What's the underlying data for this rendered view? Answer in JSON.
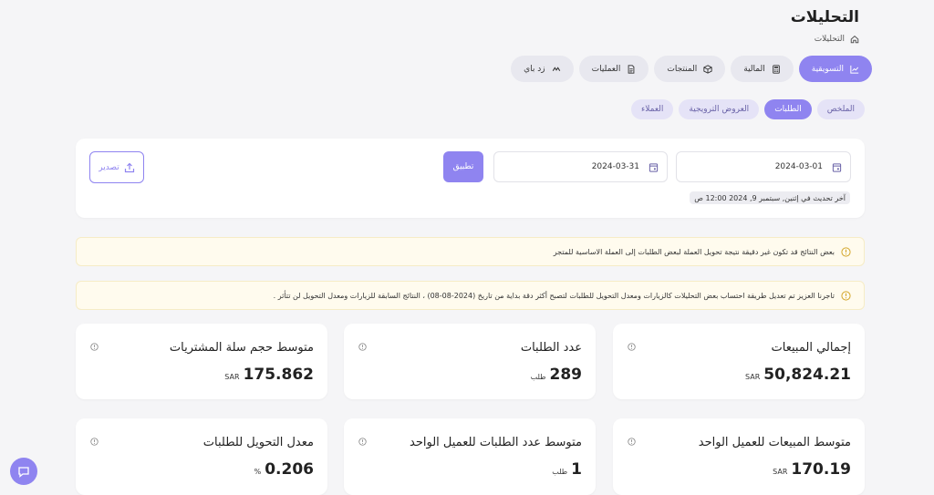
{
  "header": {
    "title": "التحليلات",
    "breadcrumb": "التحليلات"
  },
  "main_tabs": [
    {
      "label": "التسويقية",
      "icon": "chart-line-icon",
      "active": true
    },
    {
      "label": "المالية",
      "icon": "calculator-icon",
      "active": false
    },
    {
      "label": "المنتجات",
      "icon": "box-icon",
      "active": false
    },
    {
      "label": "العمليات",
      "icon": "document-icon",
      "active": false
    },
    {
      "label": "زد باي",
      "icon": "zid-pay-icon",
      "active": false
    }
  ],
  "sub_tabs": [
    {
      "label": "الملخص",
      "active": false
    },
    {
      "label": "الطلبات",
      "active": true
    },
    {
      "label": "العروض الترويجية",
      "active": false
    },
    {
      "label": "العملاء",
      "active": false
    }
  ],
  "filters": {
    "start_date": "2024-03-01",
    "end_date": "2024-03-31",
    "apply_label": "تطبيق",
    "export_label": "تصدير",
    "last_update": "آخر تحديث في إثنين, سبتمبر 9, 2024 12:00 ص"
  },
  "notices": [
    "بعض النتائج قد تكون غير دقيقة نتيجة تحويل العملة لبعض الطلبات إلى العملة الاساسية للمتجر",
    "تاجرنا العزيز تم تعديل طريقة احتساب بعض التحليلات كالزيارات ومعدل التحويل للطلبات لتصبح أكثر دقة بداية من تاريخ (2024-08-08) ، النتائج السابقة للزيارات ومعدل التحويل لن تتأثر ."
  ],
  "stats": [
    {
      "title": "إجمالي المبيعات",
      "value": "50,824.21",
      "unit": "SAR"
    },
    {
      "title": "عدد الطلبات",
      "value": "289",
      "unit": "طلب"
    },
    {
      "title": "متوسط حجم سلة المشتريات",
      "value": "175.862",
      "unit": "SAR"
    },
    {
      "title": "متوسط المبيعات للعميل الواحد",
      "value": "170.19",
      "unit": "SAR"
    },
    {
      "title": "متوسط عدد الطلبات للعميل الواحد",
      "value": "1",
      "unit": "طلب"
    },
    {
      "title": "معدل التحويل للطلبات",
      "value": "0.206",
      "unit": "%"
    }
  ],
  "colors": {
    "accent": "#8f84f0",
    "notice_bg": "#fffbee",
    "notice_icon": "#d4a72c"
  }
}
